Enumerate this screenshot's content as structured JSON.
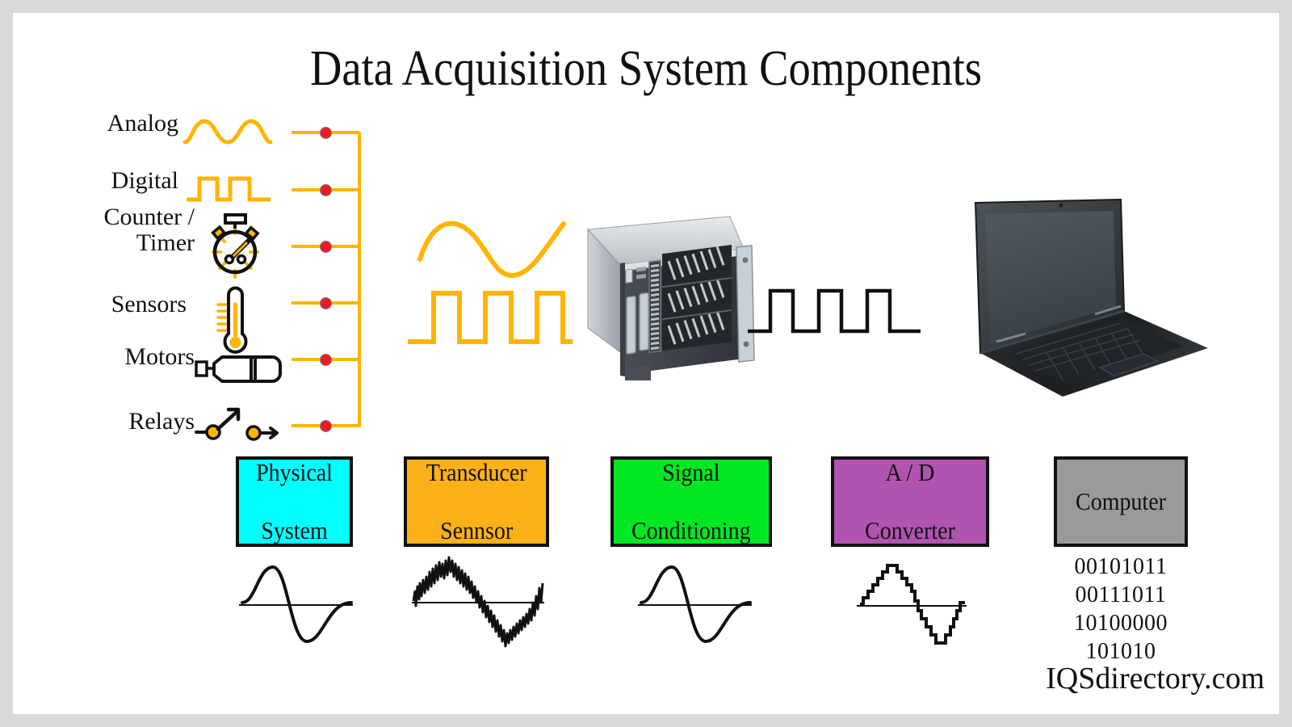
{
  "figure": {
    "title": "Data Acquisition System Components",
    "watermark": "IQSdirectory.com",
    "canvas_bg": "#ffffff",
    "frame_bg": "#d9d9d9"
  },
  "inputs": {
    "signal_color": "#ffb400",
    "node_color": "#ec1c24",
    "items": [
      {
        "label": "Analog",
        "icon": "analog-wave-icon"
      },
      {
        "label": "Digital",
        "icon": "digital-square-wave-icon"
      },
      {
        "label": "Counter /\nTimer",
        "line1": "Counter /",
        "line2": "Timer",
        "icon": "stopwatch-icon"
      },
      {
        "label": "Sensors",
        "icon": "thermometer-icon"
      },
      {
        "label": "Motors",
        "icon": "motor-icon"
      },
      {
        "label": "Relays",
        "icon": "relay-switch-icon"
      }
    ]
  },
  "stages": [
    {
      "label_line1": "Physical",
      "label_line2": "System",
      "color": "#00ffff",
      "waveform": "clean-sine"
    },
    {
      "label_line1": "Transducer",
      "label_line2": "Sennsor",
      "color": "#fbb117",
      "waveform": "noisy-sine"
    },
    {
      "label_line1": "Signal",
      "label_line2": "Conditioning",
      "color": "#00e824",
      "waveform": "clean-sine"
    },
    {
      "label_line1": "A / D",
      "label_line2": "Converter",
      "color": "#b054b0",
      "waveform": "stepped-sine"
    },
    {
      "label_line1": "Computer",
      "label_line2": "",
      "color": "#9a9a9a",
      "waveform": "binary-text"
    }
  ],
  "binary_output": [
    "00101011",
    "00111011",
    "10100000",
    "101010"
  ],
  "middle_graphics": {
    "analog_wave": "orange-sine-wave",
    "digital_wave": "orange-square-wave",
    "chassis": "rack-mount-daq-chassis",
    "digital_out_wave": "black-square-wave",
    "computer": "laptop-computer"
  }
}
